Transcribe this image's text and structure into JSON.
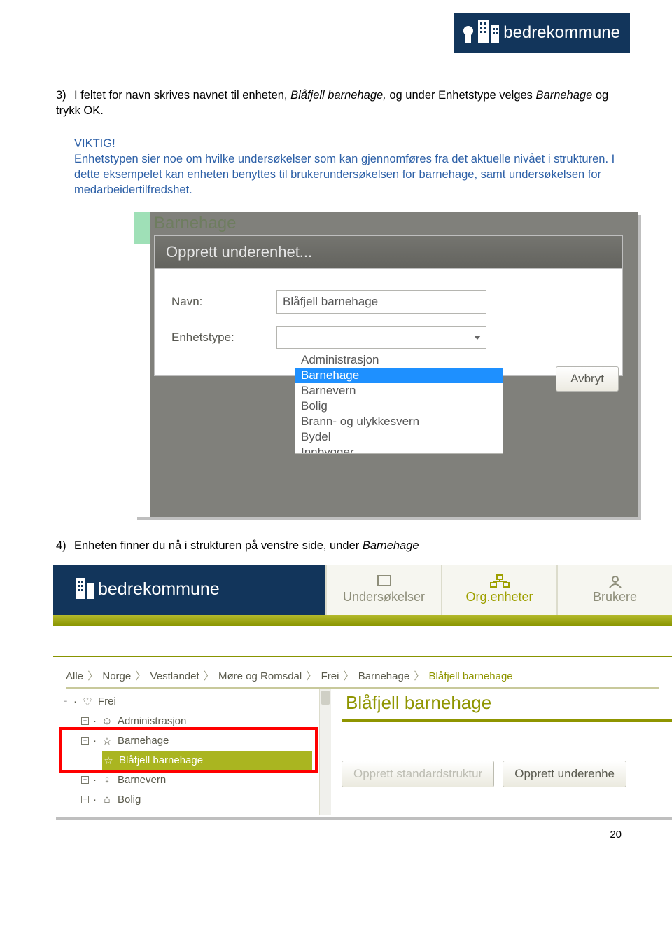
{
  "logo": {
    "brand": "bedrekommune"
  },
  "paragraph3": {
    "num": "3)",
    "text": "I feltet for navn skrives navnet til enheten, ",
    "italic": "Blåfjell barnehage,",
    "text2": " og under Enhetstype velges ",
    "italic2": "Barnehage",
    "text3": " og trykk OK."
  },
  "important": {
    "heading": "VIKTIG!",
    "body": "Enhetstypen sier noe om hvilke undersøkelser som kan gjennomføres fra det aktuelle nivået i strukturen. I dette eksempelet kan enheten benyttes til brukerundersøkelsen for barnehage, samt undersøkelsen for medarbeidertilfredshet."
  },
  "shot1": {
    "ghost": "Barnehage",
    "header": "Opprett underenhet...",
    "navn_label": "Navn:",
    "navn_value": "Blåfjell barnehage",
    "type_label": "Enhetstype:",
    "options": [
      "Administrasjon",
      "Barnehage",
      "Barnevern",
      "Bolig",
      "Brann- og ulykkesvern",
      "Bydel",
      "Innbygger"
    ],
    "selected_index": 1,
    "cancel": "Avbryt"
  },
  "paragraph4": {
    "num": "4)",
    "text": "Enheten finner du nå i strukturen på venstre side, under ",
    "italic": "Barnehage"
  },
  "shot2": {
    "brand": "bedrekommune",
    "tabs": [
      {
        "label": "Undersøkelser",
        "active": false
      },
      {
        "label": "Org.enheter",
        "active": true
      },
      {
        "label": "Brukere",
        "active": false
      }
    ],
    "breadcrumbs": [
      "Alle",
      "Norge",
      "Vestlandet",
      "Møre og Romsdal",
      "Frei",
      "Barnehage",
      "Blåfjell barnehage"
    ],
    "tree": {
      "root": "Frei",
      "items": [
        {
          "label": "Administrasjon",
          "selected": false
        },
        {
          "label": "Barnehage",
          "selected": false,
          "expanded": true
        },
        {
          "label": "Blåfjell barnehage",
          "selected": true,
          "level": 2
        },
        {
          "label": "Barnevern",
          "selected": false
        },
        {
          "label": "Bolig",
          "selected": false
        }
      ]
    },
    "detail_title": "Blåfjell barnehage",
    "btn_std": "Opprett standardstruktur",
    "btn_new": "Opprett underenhe"
  },
  "page_number": "20"
}
